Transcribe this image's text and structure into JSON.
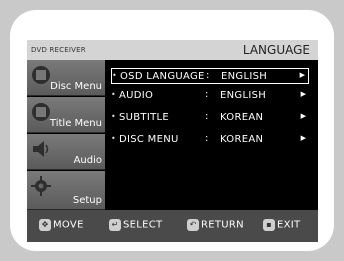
{
  "header": {
    "brand": "DVD RECEIVER",
    "title": "LANGUAGE"
  },
  "sidebar": {
    "items": [
      {
        "label": "Disc Menu",
        "icon": "disc-icon"
      },
      {
        "label": "Title Menu",
        "icon": "title-icon"
      },
      {
        "label": "Audio",
        "icon": "speaker-icon"
      },
      {
        "label": "Setup",
        "icon": "gear-icon"
      }
    ]
  },
  "menu": {
    "rows": [
      {
        "name": "OSD LANGUAGE",
        "value": "ENGLISH",
        "selected": true
      },
      {
        "name": "AUDIO",
        "value": "ENGLISH"
      },
      {
        "name": "SUBTITLE",
        "value": "KOREAN"
      },
      {
        "name": "DISC MENU",
        "value": "KOREAN"
      }
    ],
    "colon": ":",
    "arrow": "▶"
  },
  "footer": {
    "move": "MOVE",
    "select": "SELECT",
    "return": "RETURN",
    "exit": "EXIT"
  }
}
